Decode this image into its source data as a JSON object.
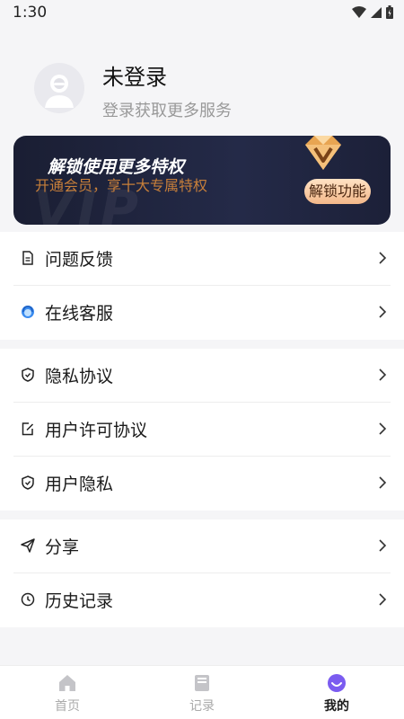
{
  "status_bar": {
    "time": "1:30"
  },
  "profile": {
    "name": "未登录",
    "subtitle": "登录获取更多服务"
  },
  "vip": {
    "watermark": "VIP",
    "title": "解锁使用更多特权",
    "subtitle": "开通会员，享十大专属特权",
    "button": "解锁功能"
  },
  "menu_group_1": [
    {
      "label": "问题反馈",
      "icon": "feedback-document-icon"
    },
    {
      "label": "在线客服",
      "icon": "customer-service-icon"
    }
  ],
  "menu_group_2": [
    {
      "label": "隐私协议",
      "icon": "shield-icon"
    },
    {
      "label": "用户许可协议",
      "icon": "edit-document-icon"
    },
    {
      "label": "用户隐私",
      "icon": "shield-icon"
    }
  ],
  "menu_group_3": [
    {
      "label": "分享",
      "icon": "paper-plane-icon"
    },
    {
      "label": "历史记录",
      "icon": "clock-icon"
    }
  ],
  "tabbar": {
    "tabs": [
      {
        "label": "首页",
        "icon": "home-icon",
        "active": false
      },
      {
        "label": "记录",
        "icon": "book-icon",
        "active": false
      },
      {
        "label": "我的",
        "icon": "smiley-icon",
        "active": true
      }
    ]
  },
  "colors": {
    "accent": "#7b5cf0",
    "vip_gold": "#c77f3a",
    "vip_bg": "#1f243f"
  }
}
